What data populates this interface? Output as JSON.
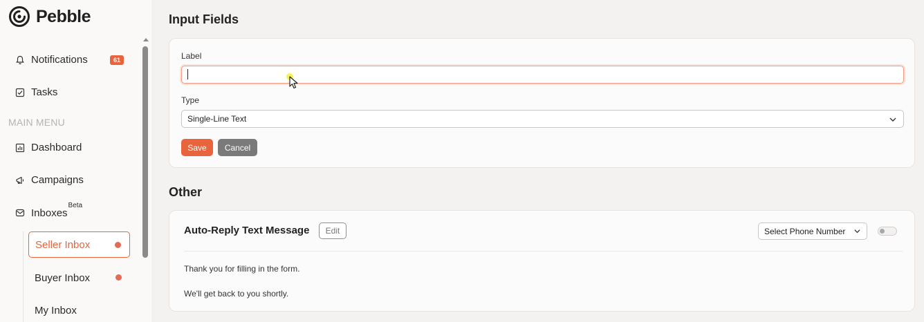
{
  "app": {
    "name": "Pebble"
  },
  "sidebar": {
    "notifications": {
      "label": "Notifications",
      "count": "61"
    },
    "tasks": {
      "label": "Tasks"
    },
    "section_label": "MAIN MENU",
    "dashboard": {
      "label": "Dashboard"
    },
    "campaigns": {
      "label": "Campaigns"
    },
    "inboxes": {
      "label": "Inboxes",
      "badge": "Beta"
    },
    "sub_items": [
      {
        "label": "Seller Inbox",
        "active": true,
        "unread": true
      },
      {
        "label": "Buyer Inbox",
        "active": false,
        "unread": true
      },
      {
        "label": "My Inbox",
        "active": false,
        "unread": false
      }
    ]
  },
  "input_fields": {
    "heading": "Input Fields",
    "label_field": {
      "label": "Label",
      "value": ""
    },
    "type_field": {
      "label": "Type",
      "selected": "Single-Line Text"
    },
    "save_label": "Save",
    "cancel_label": "Cancel"
  },
  "other": {
    "heading": "Other",
    "auto_reply": {
      "title": "Auto-Reply Text Message",
      "edit_label": "Edit",
      "phone_select": "Select Phone Number",
      "enabled": false,
      "message_lines": [
        "Thank you for filling in the form.",
        "We'll get back to you shortly."
      ]
    }
  },
  "colors": {
    "accent": "#e8643c",
    "unread_dot": "#e36a55",
    "muted": "#b6b3b0"
  }
}
